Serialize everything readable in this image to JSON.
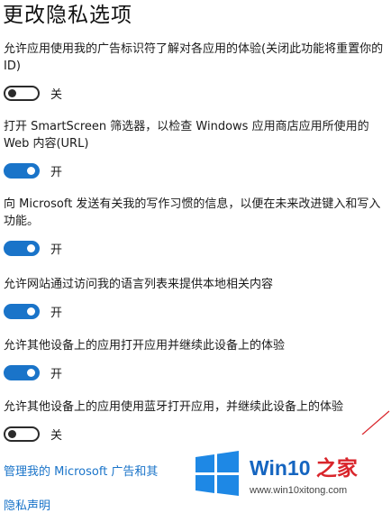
{
  "page": {
    "title": "更改隐私选项"
  },
  "settings": [
    {
      "description": "允许应用使用我的广告标识符了解对各应用的体验(关闭此功能将重置你的 ID)",
      "state": "off",
      "state_label": "关"
    },
    {
      "description": "打开 SmartScreen 筛选器，以检查 Windows 应用商店应用所使用的 Web 内容(URL)",
      "state": "on",
      "state_label": "开"
    },
    {
      "description": "向 Microsoft 发送有关我的写作习惯的信息，以便在未来改进键入和写入功能。",
      "state": "on",
      "state_label": "开"
    },
    {
      "description": "允许网站通过访问我的语言列表来提供本地相关内容",
      "state": "on",
      "state_label": "开"
    },
    {
      "description": "允许其他设备上的应用打开应用并继续此设备上的体验",
      "state": "on",
      "state_label": "开"
    },
    {
      "description": "允许其他设备上的应用使用蓝牙打开应用，并继续此设备上的体验",
      "state": "off",
      "state_label": "关"
    }
  ],
  "links": {
    "manage_ads": "管理我的 Microsoft 广告和其",
    "privacy_statement": "隐私声明"
  },
  "watermark": {
    "brand_main": "Win10",
    "brand_accent": "之家",
    "url": "www.win10xitong.com"
  },
  "colors": {
    "accent": "#1a74c9",
    "toggle_off": "#2b2b2b",
    "watermark_blue": "#1565c0",
    "watermark_red": "#d9252b"
  }
}
